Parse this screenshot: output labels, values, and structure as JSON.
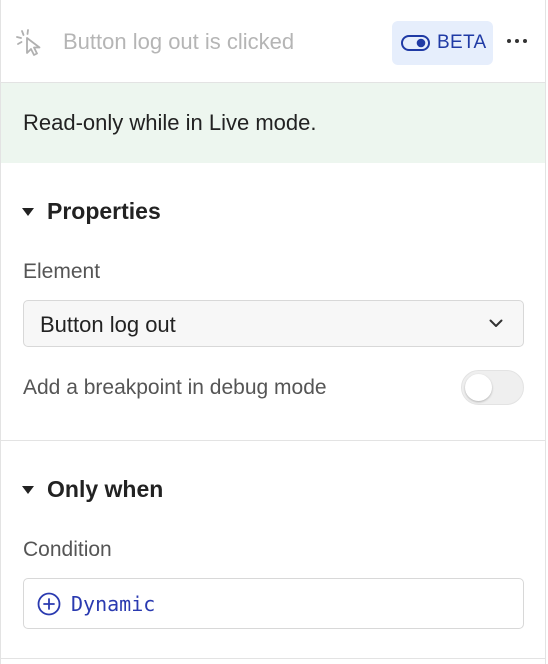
{
  "header": {
    "icon": "cursor-click-icon",
    "title": "Button log out is clicked",
    "badge_label": "BETA",
    "badge_icon": "toggle-icon",
    "more_icon": "more-horizontal-icon"
  },
  "banner": {
    "text": "Read-only while in Live mode."
  },
  "properties": {
    "title": "Properties",
    "element_label": "Element",
    "element_value": "Button log out",
    "breakpoint_label": "Add a breakpoint in debug mode",
    "breakpoint_on": false
  },
  "only_when": {
    "title": "Only when",
    "condition_label": "Condition",
    "dynamic_label": "Dynamic"
  },
  "colors": {
    "accent": "#1f3aa5",
    "banner_bg": "#edf6ef",
    "badge_bg": "#e6eefc"
  }
}
